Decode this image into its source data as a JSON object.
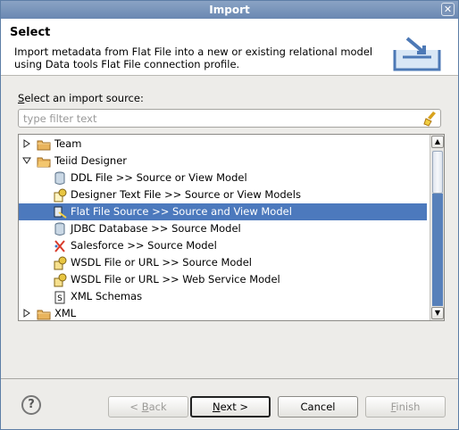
{
  "window": {
    "title": "Import",
    "close_symbol": "✕"
  },
  "header": {
    "title": "Select",
    "description": "Import metadata from Flat File into a new or existing relational model using Data tools Flat File connection profile."
  },
  "source": {
    "label_prefix": "S",
    "label_rest": "elect an import source:",
    "filter_placeholder": "type filter text",
    "filter_value": ""
  },
  "tree": {
    "items": [
      {
        "label": "Team",
        "icon": "folder-icon",
        "expanded": false
      },
      {
        "label": "Teiid Designer",
        "icon": "folder-icon",
        "expanded": true
      },
      {
        "label": "DDL File >> Source or View Model",
        "icon": "database-icon"
      },
      {
        "label": "Designer Text File >> Source or View Models",
        "icon": "text-file-import-icon"
      },
      {
        "label": "Flat File Source >> Source and View Model",
        "icon": "flat-file-icon",
        "selected": true
      },
      {
        "label": "JDBC Database >> Source Model",
        "icon": "database-icon"
      },
      {
        "label": "Salesforce >> Source Model",
        "icon": "salesforce-icon"
      },
      {
        "label": "WSDL File or URL >> Source Model",
        "icon": "wsdl-icon"
      },
      {
        "label": "WSDL File or URL >> Web Service Model",
        "icon": "wsdl-icon"
      },
      {
        "label": "XML Schemas",
        "icon": "schema-icon"
      },
      {
        "label": "XML",
        "icon": "folder-icon",
        "expanded": false
      }
    ]
  },
  "buttons": {
    "help_symbol": "?",
    "back_prefix": "< ",
    "back_mnemonic": "B",
    "back_rest": "ack",
    "next_mnemonic": "N",
    "next_rest": "ext >",
    "cancel": "Cancel",
    "finish_mnemonic": "F",
    "finish_rest": "inish"
  },
  "colors": {
    "selection": "#4c79bd",
    "title_bar": "#7993b8"
  }
}
